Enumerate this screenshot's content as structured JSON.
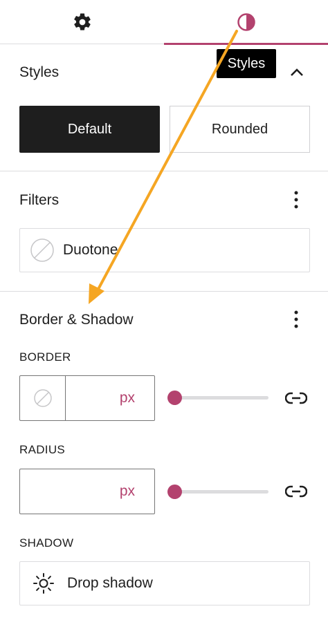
{
  "tabs": [
    {
      "icon": "gear-icon",
      "label": "Settings"
    },
    {
      "icon": "half-circle-icon",
      "label": "Styles",
      "active": true
    }
  ],
  "tooltip": "Styles",
  "styles_panel": {
    "title": "Styles",
    "buttons": [
      {
        "label": "Default",
        "selected": true
      },
      {
        "label": "Rounded",
        "selected": false
      }
    ]
  },
  "filters_panel": {
    "title": "Filters",
    "duotone_label": "Duotone"
  },
  "border_panel": {
    "title": "Border & Shadow",
    "border": {
      "label": "BORDER",
      "unit": "px",
      "value": "",
      "slider_value": 0
    },
    "radius": {
      "label": "RADIUS",
      "unit": "px",
      "value": "",
      "slider_value": 0
    },
    "shadow": {
      "label": "SHADOW",
      "option_label": "Drop shadow"
    }
  },
  "colors": {
    "accent": "#b3426e",
    "annotation_arrow": "#f5a623",
    "primary_button_bg": "#1e1e1e"
  }
}
